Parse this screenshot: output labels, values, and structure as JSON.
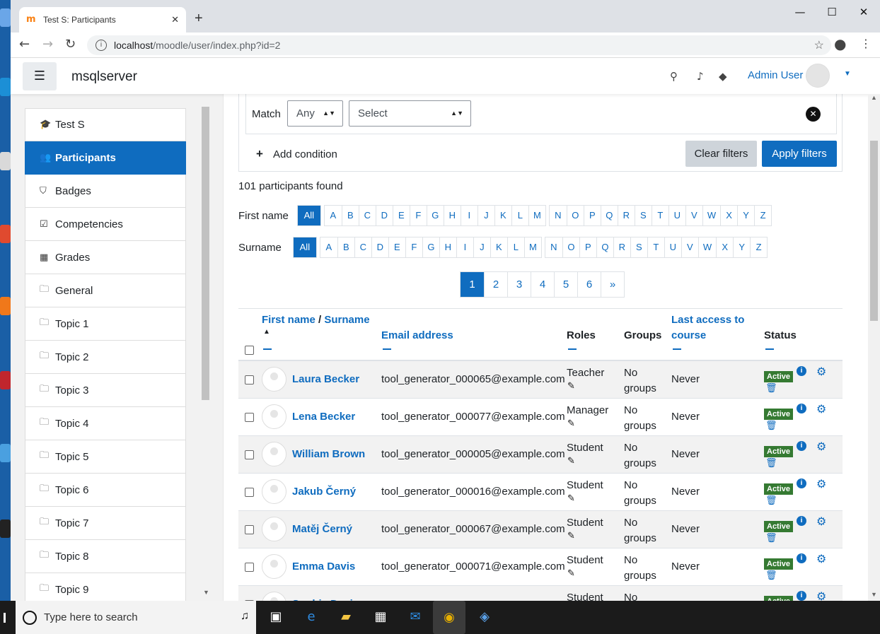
{
  "browser": {
    "tab_title": "Test S: Participants",
    "url_host": "localhost",
    "url_path": "/moodle/user/index.php?id=2"
  },
  "navbar": {
    "site_name": "msqlserver",
    "user_name": "Admin User"
  },
  "drawer": {
    "items": [
      {
        "label": "Test S",
        "icon": "graduation-cap-icon"
      },
      {
        "label": "Participants",
        "icon": "users-icon",
        "active": true
      },
      {
        "label": "Badges",
        "icon": "shield-icon"
      },
      {
        "label": "Competencies",
        "icon": "check-square-icon"
      },
      {
        "label": "Grades",
        "icon": "table-icon"
      },
      {
        "label": "General",
        "icon": "folder-icon"
      },
      {
        "label": "Topic 1",
        "icon": "folder-icon"
      },
      {
        "label": "Topic 2",
        "icon": "folder-icon"
      },
      {
        "label": "Topic 3",
        "icon": "folder-icon"
      },
      {
        "label": "Topic 4",
        "icon": "folder-icon"
      },
      {
        "label": "Topic 5",
        "icon": "folder-icon"
      },
      {
        "label": "Topic 6",
        "icon": "folder-icon"
      },
      {
        "label": "Topic 7",
        "icon": "folder-icon"
      },
      {
        "label": "Topic 8",
        "icon": "folder-icon"
      },
      {
        "label": "Topic 9",
        "icon": "folder-icon"
      }
    ]
  },
  "filters": {
    "match_label": "Match",
    "match_value": "Any",
    "select_value": "Select",
    "add_condition": "Add condition",
    "clear_filters": "Clear filters",
    "apply_filters": "Apply filters"
  },
  "summary": "101 participants found",
  "initials": {
    "firstname_label": "First name",
    "surname_label": "Surname",
    "all_label": "All",
    "groups": [
      [
        "A",
        "B",
        "C",
        "D",
        "E",
        "F",
        "G",
        "H",
        "I",
        "J",
        "K",
        "L",
        "M"
      ],
      [
        "N",
        "O",
        "P",
        "Q",
        "R",
        "S",
        "T",
        "U",
        "V",
        "W",
        "X",
        "Y",
        "Z"
      ]
    ]
  },
  "pagination": [
    "1",
    "2",
    "3",
    "4",
    "5",
    "6",
    "»"
  ],
  "table": {
    "headers": {
      "first_name": "First name",
      "slash": " / ",
      "surname": "Surname",
      "sort_arrow": "▲",
      "email": "Email address",
      "roles": "Roles",
      "groups": "Groups",
      "last_access_1": "Last access to",
      "last_access_2": "course",
      "status": "Status"
    },
    "rows": [
      {
        "name": "Laura Becker",
        "email": "tool_generator_000065@example.com",
        "role": "Teacher",
        "groups": "No groups",
        "last_access": "Never",
        "status": "Active"
      },
      {
        "name": "Lena Becker",
        "email": "tool_generator_000077@example.com",
        "role": "Manager",
        "groups": "No groups",
        "last_access": "Never",
        "status": "Active"
      },
      {
        "name": "William Brown",
        "email": "tool_generator_000005@example.com",
        "role": "Student",
        "groups": "No groups",
        "last_access": "Never",
        "status": "Active"
      },
      {
        "name": "Jakub Černý",
        "email": "tool_generator_000016@example.com",
        "role": "Student",
        "groups": "No groups",
        "last_access": "Never",
        "status": "Active"
      },
      {
        "name": "Matěj Černý",
        "email": "tool_generator_000067@example.com",
        "role": "Student",
        "groups": "No groups",
        "last_access": "Never",
        "status": "Active"
      },
      {
        "name": "Emma Davis",
        "email": "tool_generator_000071@example.com",
        "role": "Student",
        "groups": "No groups",
        "last_access": "Never",
        "status": "Active"
      },
      {
        "name": "Sophia Davis",
        "email": "",
        "role": "Student",
        "groups": "No",
        "last_access": "",
        "status": "Active"
      }
    ]
  },
  "taskbar": {
    "search_placeholder": "Type here to search"
  },
  "colors": {
    "primary": "#0f6cbf",
    "active_badge": "#357a32",
    "drawer_bg": "#f2f2f2",
    "taskbar": "#1b1b1b"
  }
}
